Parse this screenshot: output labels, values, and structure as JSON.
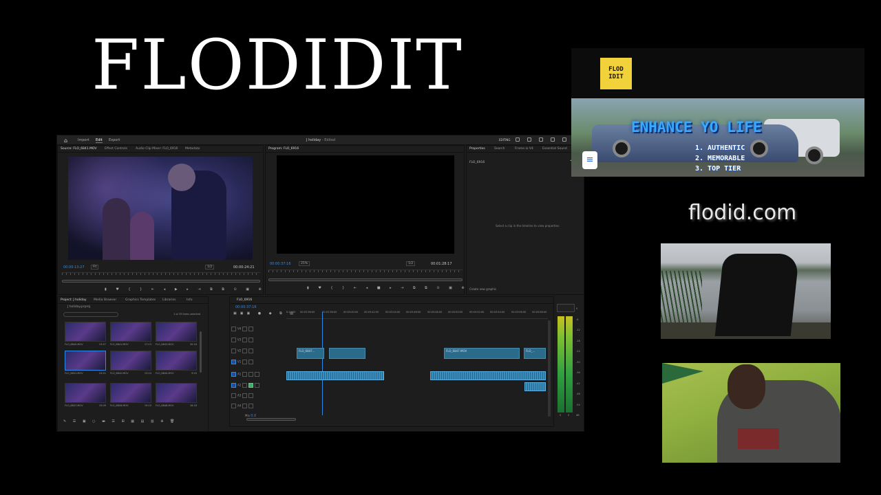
{
  "brand": {
    "title": "FLODIDIT"
  },
  "premiere": {
    "topbar": {
      "nav": [
        "Import",
        "Edit",
        "Export"
      ],
      "project_title": "J holiday",
      "edited": "- Edited",
      "workspace": "EDITING"
    },
    "source": {
      "tabs": [
        "Source: FLO_6841.MOV",
        "Effect Controls",
        "Audio Clip Mixer: FLO_6916",
        "Metadata"
      ],
      "timecode": "00:00:13:27",
      "fit": "Fit",
      "ratio": "1/2",
      "duration": "00:00:24:21"
    },
    "program": {
      "tab": "Program: FLO_6916",
      "timecode": "00:00:37:16",
      "fit": "25%",
      "ratio": "1/2",
      "duration": "00:01:28:17"
    },
    "properties": {
      "tabs": [
        "Properties",
        "Search",
        "Frame.io V4",
        "Essential Sound"
      ],
      "clip": "FLO_6916",
      "message": "Select a clip in the timeline to view properties.",
      "create_graphic": "Create new graphic"
    },
    "project": {
      "tabs": [
        "Project: J holiday",
        "Media Browser",
        "Graphics Templates",
        "Libraries",
        "Info"
      ],
      "file": "J holiday.prproj",
      "selection": "1 of 33 items selected",
      "items": [
        {
          "name": "FLO_6840.MOV",
          "dur": "13:27"
        },
        {
          "name": "FLO_6841.MOV",
          "dur": "17:13"
        },
        {
          "name": "FLO_6843.MOV",
          "dur": "30:16"
        },
        {
          "name": "FLO_6841.MOV",
          "dur": "24:21"
        },
        {
          "name": "FLO_6842.MOV",
          "dur": "13:24"
        },
        {
          "name": "FLO_6840.MOV",
          "dur": "9:20"
        },
        {
          "name": "FLO_6847.MOV",
          "dur": "15:09"
        },
        {
          "name": "FLO_6828.MOV",
          "dur": "19:15"
        },
        {
          "name": "FLO_6848.MOV",
          "dur": "18:18"
        }
      ]
    },
    "timeline": {
      "tab": "FLO_6916",
      "timecode": "00:00:37:16",
      "ruler": [
        "0:14:00",
        "00:03:36:00",
        "00:03:38:00",
        "00:03:40:00",
        "00:03:42:00",
        "00:03:44:00",
        "00:03:46:00",
        "00:03:48:00",
        "00:03:50:00",
        "00:03:52:00",
        "00:03:54:00",
        "00:03:56:00",
        "00:03:58:00"
      ],
      "tracks": [
        "V4",
        "V3",
        "V2",
        "V1",
        "A1",
        "A2",
        "A3",
        "A4",
        "Mix"
      ],
      "mix_value": "0.0",
      "clips": [
        "FLO_6847...",
        "FLO_6847.MOV",
        "FLO_..."
      ]
    },
    "meter_scale": [
      "0",
      "-6",
      "-12",
      "-18",
      "-24",
      "-30",
      "-36",
      "-42",
      "-48",
      "-54",
      "dB"
    ],
    "meter_labels": [
      "S",
      "S"
    ]
  },
  "promo": {
    "logo": "FLOD\nIDIT",
    "headline": "ENHANCE YO LIFE",
    "list": [
      "1. AUTHENTIC",
      "2. MEMORABLE",
      "3. TOP TIER"
    ]
  },
  "site": "flodid.com",
  "colors": {
    "accent": "#2d8ceb",
    "logo_bg": "#f2d23a",
    "headline": "#3aa8ff"
  }
}
